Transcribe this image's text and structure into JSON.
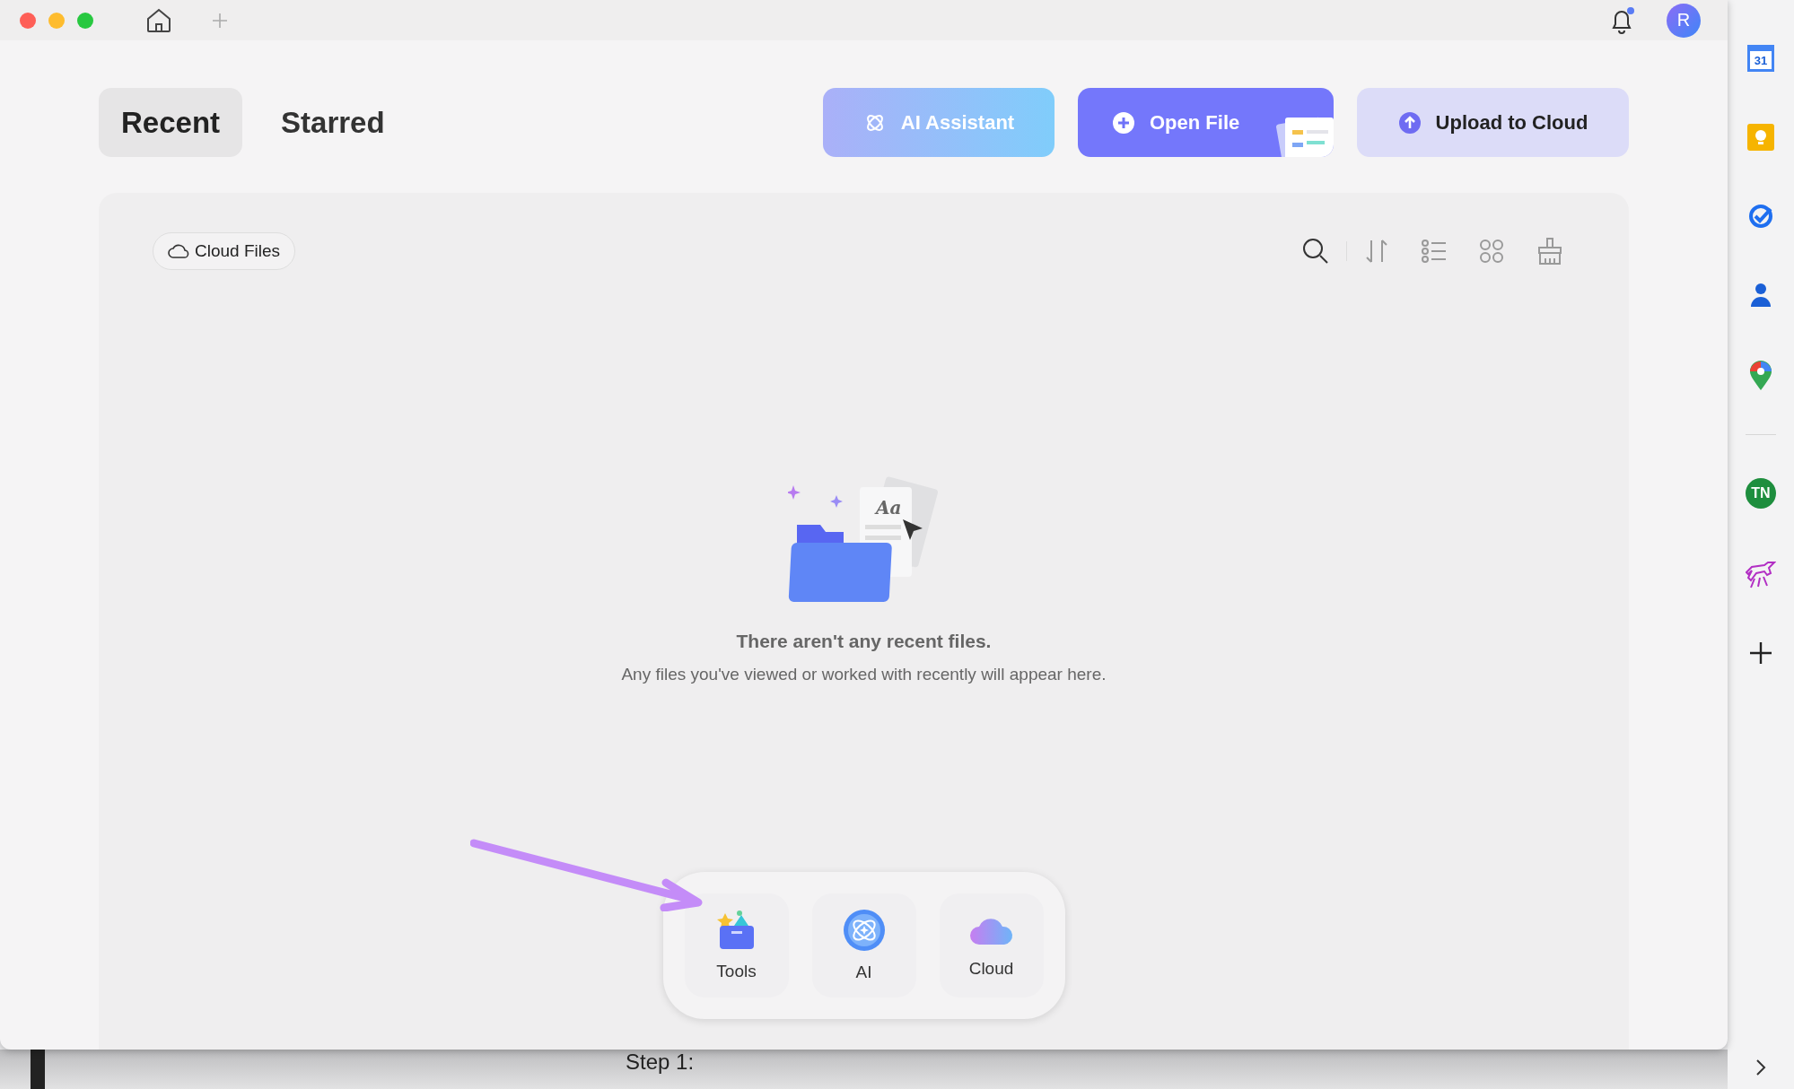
{
  "top_bar": {
    "avatar": "R",
    "notification_dot": true
  },
  "tabs": [
    {
      "label": "Recent",
      "selected": true
    },
    {
      "label": "Starred",
      "selected": false
    }
  ],
  "action_buttons": [
    {
      "kind": "ai",
      "label": "AI Assistant"
    },
    {
      "kind": "open",
      "label": "Open File"
    },
    {
      "kind": "upload",
      "label": "Upload to Cloud"
    }
  ],
  "panel": {
    "chip": "Cloud Files",
    "illustration_text": "Aa",
    "empty_title": "There aren't any recent files.",
    "empty_message": "Any files you've viewed or worked with recently will appear here."
  },
  "dock": [
    {
      "kind": "tools",
      "label": "Tools"
    },
    {
      "kind": "ai",
      "label": "AI"
    },
    {
      "kind": "cloud",
      "label": "Cloud"
    }
  ],
  "background_text": "Step 1:",
  "sidebar": [
    {
      "kind": "calendar",
      "text": "31"
    },
    {
      "kind": "keep"
    },
    {
      "kind": "tasks"
    },
    {
      "kind": "contacts"
    },
    {
      "kind": "maps"
    },
    {
      "kind": "divider"
    },
    {
      "kind": "badge",
      "text": "TN"
    },
    {
      "kind": "unicorn"
    },
    {
      "kind": "add"
    }
  ]
}
